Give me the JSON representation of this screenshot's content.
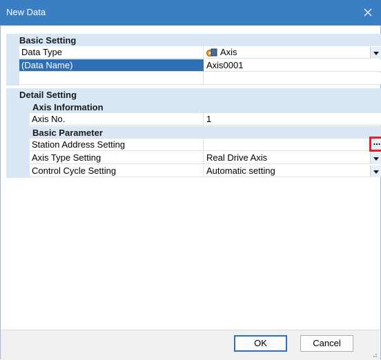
{
  "window": {
    "title": "New Data",
    "close_icon": "close-icon"
  },
  "basic_setting": {
    "header": "Basic Setting",
    "data_type": {
      "label": "Data Type",
      "value": "Axis",
      "icon": "axis-icon"
    },
    "data_name": {
      "label": "(Data Name)",
      "value": "Axis0001"
    }
  },
  "detail_setting": {
    "header": "Detail Setting",
    "axis_information": {
      "header": "Axis Information",
      "axis_no": {
        "label": "Axis No.",
        "value": "1"
      }
    },
    "basic_parameter": {
      "header": "Basic Parameter",
      "station_address": {
        "label": "Station Address Setting",
        "value": "",
        "button": "..."
      },
      "axis_type": {
        "label": "Axis Type Setting",
        "value": "Real Drive Axis"
      },
      "control_cycle": {
        "label": "Control Cycle Setting",
        "value": "Automatic setting"
      }
    }
  },
  "buttons": {
    "ok": "OK",
    "cancel": "Cancel"
  },
  "colors": {
    "titlebar": "#3a7fc4",
    "section": "#d9e6f3",
    "selection": "#2f6fb6",
    "highlight": "#e0242d"
  }
}
